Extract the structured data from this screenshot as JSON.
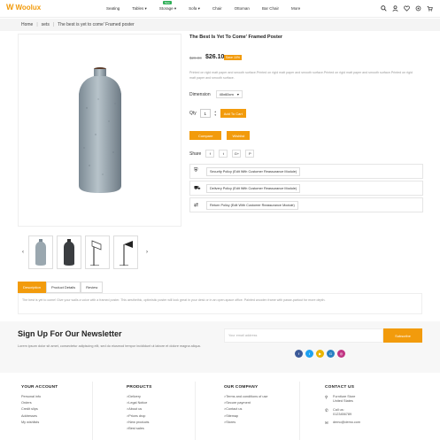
{
  "header": {
    "logo_text": "Woolux",
    "nav": [
      {
        "label": "Seating",
        "chevron": false
      },
      {
        "label": "Tables",
        "chevron": true
      },
      {
        "label": "Storage",
        "chevron": true,
        "badge": "New"
      },
      {
        "label": "Sofa",
        "chevron": true
      },
      {
        "label": "Chair",
        "chevron": false
      },
      {
        "label": "Ottoman",
        "chevron": false
      },
      {
        "label": "Bar Chair",
        "chevron": false
      },
      {
        "label": "More",
        "chevron": false
      }
    ],
    "icons": [
      "search-icon",
      "user-icon",
      "heart-icon",
      "settings-icon",
      "cart-icon"
    ],
    "cart_count": "0"
  },
  "breadcrumb": {
    "home": "Home",
    "sep": "|",
    "category": "sets",
    "current": "The best is yet to come' Framed poster"
  },
  "product": {
    "title": "The Best Is Yet To Come' Framed Poster",
    "old_price": "$29.00",
    "price": "$26.10",
    "save": "Save 10%",
    "description": "Printed on rigid matt paper and smooth surface.Printed on rigid matt paper and smooth surface.Printed on rigid matt paper and smooth surface.Printed on rigid matt paper and smooth surface.",
    "dimension_label": "Dimension",
    "dimension_value": "40x60cm",
    "qty_label": "Qty",
    "qty_value": "1",
    "add_to_cart": "Add To Cart",
    "compare": "Compare",
    "wishlist": "Wishlist",
    "share_label": "Share",
    "share": [
      "f",
      "t",
      "G+",
      "P"
    ]
  },
  "policies": [
    {
      "icon": "shield-icon",
      "label": "Security Policy (Edit With Customer Reassurance Module)"
    },
    {
      "icon": "truck-icon",
      "label": "Delivery Policy (Edit With Customer Reassurance Module)"
    },
    {
      "icon": "return-icon",
      "label": "Return Policy (Edit With Customer Reassurance Module)"
    }
  ],
  "tabs": {
    "items": [
      "Description",
      "Product Details",
      "Review"
    ],
    "active": 0,
    "content": "The best is yet to come! Give your walls a voice with a framed poster. This aesthethic, optimistic poster will look great in your desk or in an open-space office. Painted wooden frame with passe-partout for more depth."
  },
  "newsletter": {
    "title": "Sign Up For Our Newsletter",
    "subtitle": "Lorem ipsum dolor sit amet, consectetur adipiscing elit, sed do eiusmod tempor incididunt ut labore et dolore magna aliqua.",
    "placeholder": "Your email address",
    "button": "Subscribe",
    "socials": [
      {
        "icon": "facebook-icon",
        "glyph": "f",
        "color": "#3b5998"
      },
      {
        "icon": "twitter-icon",
        "glyph": "t",
        "color": "#1da1f2"
      },
      {
        "icon": "youtube-icon",
        "glyph": "▶",
        "color": "#e8b400"
      },
      {
        "icon": "google-icon",
        "glyph": "G",
        "color": "#2a80c2"
      },
      {
        "icon": "instagram-icon",
        "glyph": "◎",
        "color": "#c13584"
      }
    ]
  },
  "footer": {
    "account": {
      "title": "YOUR ACCOUNT",
      "links": [
        "Personal info",
        "Orders",
        "Credit slips",
        "Addresses",
        "My wishlists"
      ]
    },
    "products": {
      "title": "PRODUCTS",
      "links": [
        "Delivery",
        "Legal Notice",
        "About us",
        "Prices drop",
        "New products",
        "Best sales"
      ]
    },
    "company": {
      "title": "OUR COMPANY",
      "links": [
        "Terms and conditions of use",
        "Secure payment",
        "Contact us",
        "Sitemap",
        "Stores"
      ]
    },
    "contact": {
      "title": "CONTACT US",
      "address": "Furniture Store\nUnited States",
      "phone_label": "Call us:",
      "phone": "0123456789",
      "email": "demo@demo.com"
    }
  },
  "colors": {
    "accent": "#f29b0c"
  }
}
